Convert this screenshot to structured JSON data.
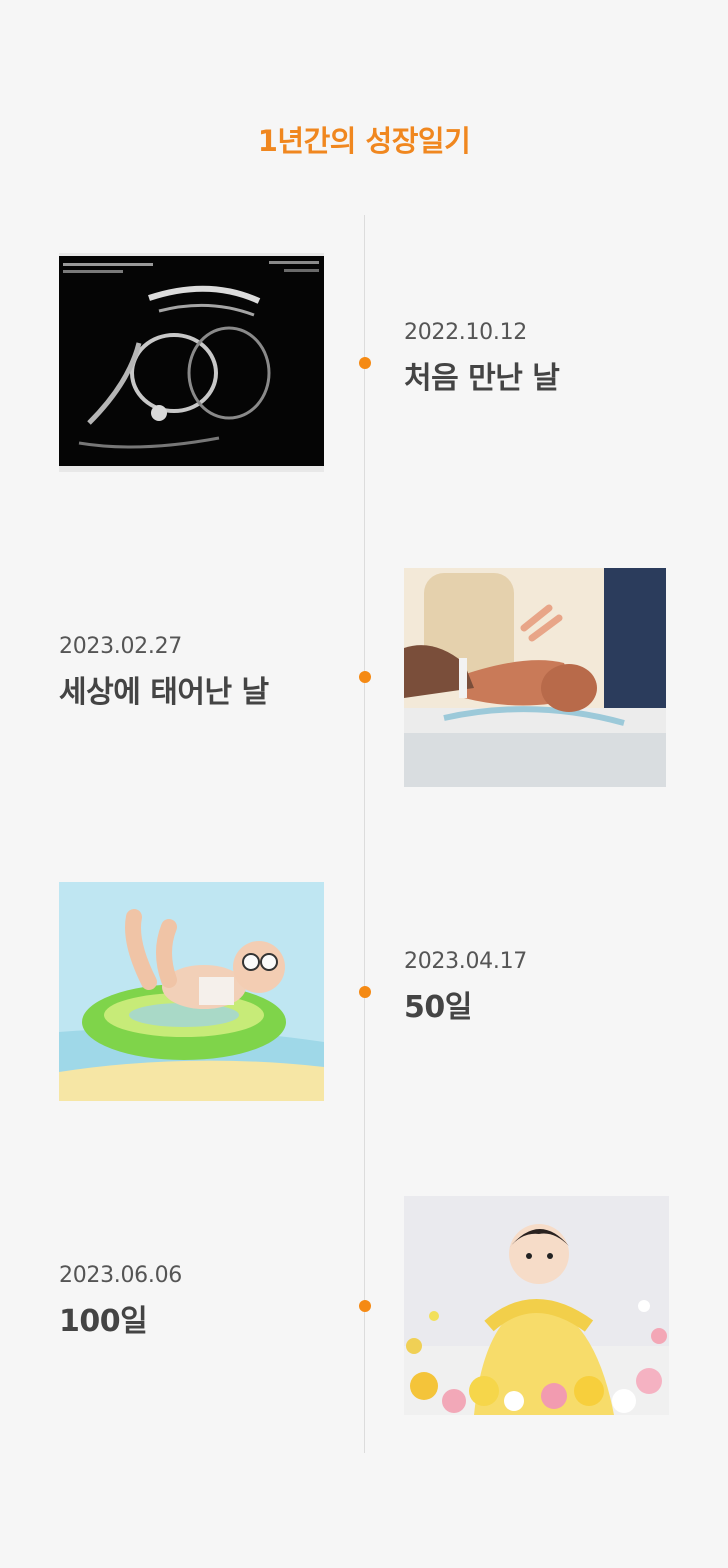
{
  "page_title": "1년간의 성장일기",
  "accent_color": "#f58a14",
  "entries": [
    {
      "date": "2022.10.12",
      "caption": "처음 만난 날",
      "photo": "ultrasound-photo"
    },
    {
      "date": "2023.02.27",
      "caption": "세상에 태어난 날",
      "photo": "newborn-photo"
    },
    {
      "date": "2023.04.17",
      "caption": "50일",
      "photo": "baby-float-photo"
    },
    {
      "date": "2023.06.06",
      "caption": "100일",
      "photo": "baby-flowers-photo"
    }
  ]
}
